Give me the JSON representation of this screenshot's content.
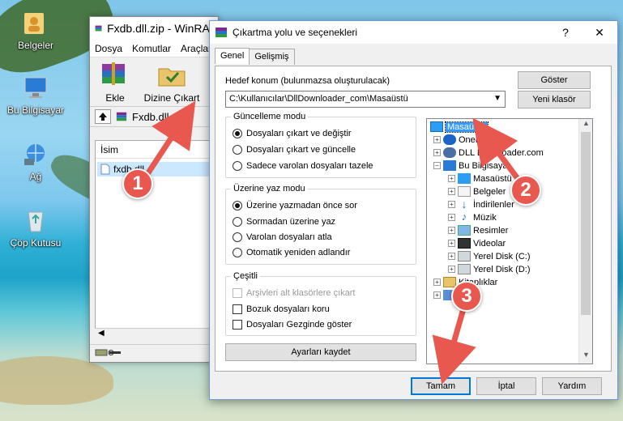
{
  "colors": {
    "accent": "#e9584e",
    "selection": "#3399ff",
    "dialog_border": "#6b9ad8"
  },
  "desktop": {
    "icons": [
      {
        "label": "Belgeler",
        "icon": "folder-user-icon"
      },
      {
        "label": "Bu Bilgisayar",
        "icon": "computer-icon"
      },
      {
        "label": "Ağ",
        "icon": "network-icon"
      },
      {
        "label": "Çöp Kutusu",
        "icon": "recycle-bin-icon"
      }
    ]
  },
  "winrar": {
    "title": "Fxdb.dll.zip - WinRAR",
    "menu": [
      "Dosya",
      "Komutlar",
      "Araçlar"
    ],
    "toolbar": {
      "add_label": "Ekle",
      "extract_label": "Dizine Çıkart"
    },
    "address": "Fxdb.dll.zip",
    "list_header": "İsim",
    "file_name": "fxdb.dll"
  },
  "dialog": {
    "title": "Çıkartma yolu ve seçenekleri",
    "help": "?",
    "close": "✕",
    "tabs": [
      "Genel",
      "Gelişmiş"
    ],
    "target_label": "Hedef konum (bulunmazsa oluşturulacak)",
    "target_value": "C:\\Kullanıcılar\\DllDownloader_com\\Masaüstü",
    "show_button": "Göster",
    "new_folder_button": "Yeni klasör",
    "update_mode": {
      "title": "Güncelleme modu",
      "options": [
        "Dosyaları çıkart ve değiştir",
        "Dosyaları çıkart ve güncelle",
        "Sadece varolan dosyaları tazele"
      ]
    },
    "overwrite_mode": {
      "title": "Üzerine yaz modu",
      "options": [
        "Üzerine yazmadan önce sor",
        "Sormadan üzerine yaz",
        "Varolan dosyaları atla",
        "Otomatik yeniden adlandır"
      ]
    },
    "misc": {
      "title": "Çeşitli",
      "options": [
        "Arşivleri alt klasörlere çıkart",
        "Bozuk dosyaları koru",
        "Dosyaları Gezginde göster"
      ]
    },
    "save_settings": "Ayarları kaydet",
    "tree": [
      "Masaüstü",
      "OneDrive",
      "DLL Downloader.com",
      "Bu Bilgisayar",
      "Masaüstü",
      "Belgeler",
      "İndirilenler",
      "Müzik",
      "Resimler",
      "Videolar",
      "Yerel Disk (C:)",
      "Yerel Disk (D:)",
      "Kitaplıklar",
      "Ağ"
    ],
    "buttons": {
      "ok": "Tamam",
      "cancel": "İptal",
      "help": "Yardım"
    }
  },
  "annotations": {
    "steps": [
      "1",
      "2",
      "3"
    ]
  }
}
